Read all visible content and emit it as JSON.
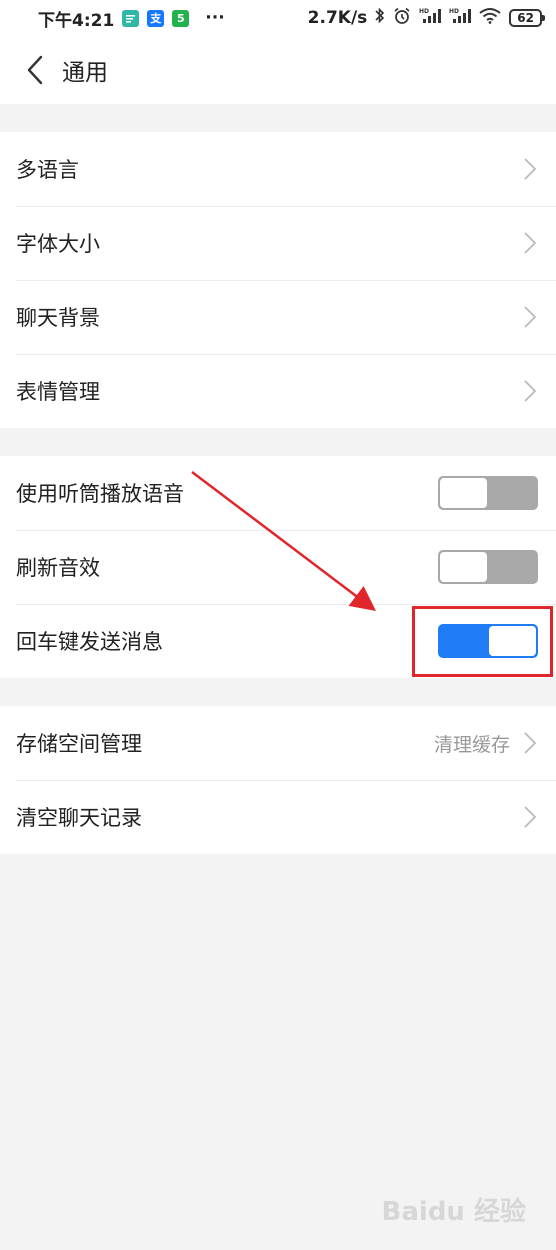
{
  "status_bar": {
    "time": "下午4:21",
    "more": "···",
    "speed": "2.7K/s",
    "battery": "62",
    "app_icons": [
      {
        "name": "message-app-icon",
        "color": "#2fb8a6"
      },
      {
        "name": "alipay-app-icon",
        "color": "#1677ff",
        "glyph": "支"
      },
      {
        "name": "chat-app-icon",
        "color": "#23b14d",
        "glyph": "5"
      }
    ]
  },
  "nav": {
    "title": "通用"
  },
  "group1": [
    {
      "label": "多语言"
    },
    {
      "label": "字体大小"
    },
    {
      "label": "聊天背景"
    },
    {
      "label": "表情管理"
    }
  ],
  "group2": [
    {
      "label": "使用听筒播放语音",
      "toggle": "off"
    },
    {
      "label": "刷新音效",
      "toggle": "off"
    },
    {
      "label": "回车键发送消息",
      "toggle": "on"
    }
  ],
  "group3": [
    {
      "label": "存储空间管理",
      "value": "清理缓存"
    },
    {
      "label": "清空聊天记录"
    }
  ],
  "colors": {
    "accent": "#1f7cf6",
    "toggle_off": "#a9a9a9",
    "annotation": "#e0252b"
  },
  "watermark": "Baidu 经验"
}
